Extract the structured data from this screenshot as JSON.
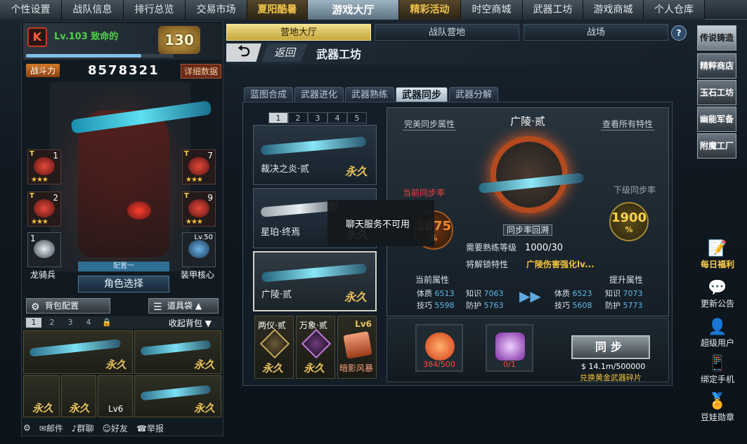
{
  "top_nav": [
    "个性设置",
    "战队信息",
    "排行总览",
    "交易市场",
    "夏阳酷暑",
    "游戏大厅",
    "精彩活动",
    "时空商城",
    "武器工坊",
    "游戏商城",
    "个人仓库"
  ],
  "player": {
    "level_text": "Lv.103 致命的",
    "rank": "130",
    "xp_progress": 0.78,
    "power_label": "战斗力",
    "power_value": "8578321",
    "detail_label": "详细数据"
  },
  "slots": [
    {
      "tier": "T",
      "num": "1",
      "stars": "★★★"
    },
    {
      "tier": "T",
      "num": "7",
      "stars": "★★★"
    },
    {
      "tier": "T",
      "num": "2",
      "stars": "★★★"
    },
    {
      "tier": "T",
      "num": "9",
      "stars": "★★★"
    },
    {
      "tier": "",
      "num": "1",
      "stars": ""
    },
    {
      "tier": "",
      "num": "Lv.50",
      "stars": ""
    }
  ],
  "slot_labels": {
    "dragon": "龙骑兵",
    "armor": "装甲核心"
  },
  "preset_label": "配置一",
  "role_select": "角色选择",
  "config_buttons": {
    "bag": "背包配置",
    "items": "道具袋"
  },
  "bag_tabs": [
    "1",
    "2",
    "3",
    "4"
  ],
  "bag_lock": "🔒",
  "collapse_bag": "收起背包",
  "bag_items": [
    {
      "label": "永久"
    },
    {
      "label": "永久"
    },
    {
      "label": "永久"
    },
    {
      "label": "永久"
    },
    {
      "label": "Lv6"
    },
    {
      "label": "永久"
    }
  ],
  "bottom_links": [
    "邮件",
    "群聊",
    "好友",
    "举报"
  ],
  "sub_tabs": [
    "营地大厅",
    "战队营地",
    "战场"
  ],
  "help": "?",
  "back_label": "返回",
  "page_title": "武器工坊",
  "workshop_tabs": [
    "蓝图合成",
    "武器进化",
    "武器熟练",
    "武器同步",
    "武器分解"
  ],
  "list_pages": [
    "1",
    "2",
    "3",
    "4",
    "5"
  ],
  "weapons": [
    {
      "name": "裁决之炎·贰",
      "perm": "永久"
    },
    {
      "name": "星珀·终焉",
      "perm": "永久"
    },
    {
      "name": "广陵·贰",
      "perm": "永久"
    }
  ],
  "small_items": [
    {
      "name": "两仪·贰",
      "perm": "永久"
    },
    {
      "name": "万象·贰",
      "perm": "永久"
    },
    {
      "name": "暗影风暴",
      "lv": "Lv6"
    }
  ],
  "sync": {
    "title": "广陵·贰",
    "perfect_link": "完美同步属性",
    "view_link": "查看所有特性",
    "current_rate_label": "当前同步率",
    "current_rate": "1875",
    "next_rate_label": "下级同步率",
    "next_rate": "1900",
    "percent": "%",
    "rate_tag": "同步率回溯",
    "need_label": "需要熟练等级",
    "need_value": "1000/30",
    "unlock_label": "将解锁特性",
    "unlock_value": "广陵伤害强化lv...",
    "current_attr": "当前属性",
    "next_attr": "提升属性",
    "cur_stats": [
      [
        "体质",
        "6513"
      ],
      [
        "知识",
        "7063"
      ],
      [
        "技巧",
        "5598"
      ],
      [
        "防护",
        "5763"
      ]
    ],
    "next_stats": [
      [
        "体质",
        "6523"
      ],
      [
        "知识",
        "7073"
      ],
      [
        "技巧",
        "5608"
      ],
      [
        "防护",
        "5773"
      ]
    ],
    "arrows": "▶▶",
    "mat1_count": "384/500",
    "mat2_count": "0/1",
    "sync_button": "同步",
    "money": "14.1m/500000",
    "exchange": "兑换黄金武器碎片"
  },
  "tooltip": "聊天服务不可用",
  "right_buttons": [
    "传说铸造",
    "精粹商店",
    "玉石工坊",
    "幽能军备",
    "附魔工厂"
  ],
  "right_icons": [
    {
      "label": "每日福利",
      "icon": "📝"
    },
    {
      "label": "更新公告",
      "icon": "💬"
    },
    {
      "label": "超级用户",
      "icon": "👤"
    },
    {
      "label": "绑定手机",
      "icon": "📱"
    },
    {
      "label": "豆娃勋章",
      "icon": "🏅"
    }
  ],
  "colors": {
    "accent": "#f3c33c",
    "active_tab": "#9eb4c2",
    "rate_red": "#e7443c"
  }
}
